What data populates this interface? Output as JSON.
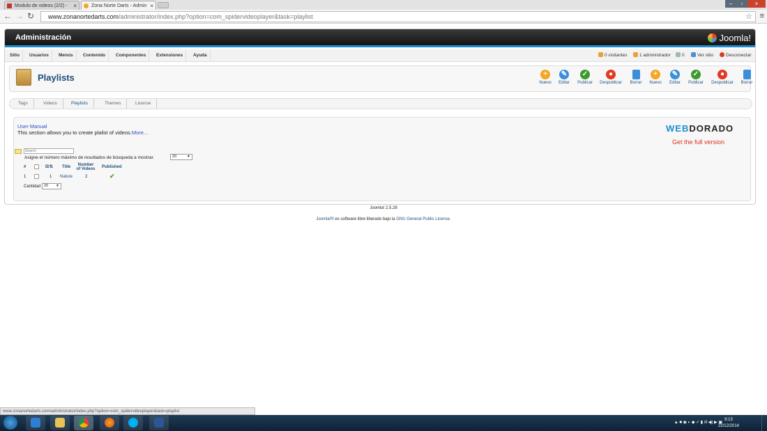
{
  "browser": {
    "tabs": [
      {
        "label": "Modulo de videos (2/2) - ",
        "active": false
      },
      {
        "label": "Zona Norte Darts - Admin",
        "active": true
      }
    ],
    "url_host": "www.zonanortedarts.com",
    "url_path": "/administrator/index.php?option=com_spidervideoplayer&task=playlist",
    "status_url": "www.zonanortedarts.com/administrator/index.php?option=com_spidervideoplayer&task=playlist"
  },
  "admin": {
    "title": "Administración",
    "brand": "Joomla!",
    "menu": [
      "Sitio",
      "Usuarios",
      "Menús",
      "Contenido",
      "Componentes",
      "Extensiones",
      "Ayuda"
    ],
    "status": {
      "visitors": "0 visitantes",
      "admins": "1 administrador",
      "messages": "0",
      "view_site": "Ver sitio",
      "logout": "Desconectar"
    }
  },
  "toolbar": {
    "page_title": "Playlists",
    "buttons": [
      {
        "label": "Nuevo",
        "icon": "plus-icon",
        "color": "#f5a623"
      },
      {
        "label": "Editar",
        "icon": "pencil-icon",
        "color": "#3a8fd8"
      },
      {
        "label": "Publicar",
        "icon": "check-icon",
        "color": "#3c9a2e"
      },
      {
        "label": "Despublicar",
        "icon": "unpublish-icon",
        "color": "#e23a22"
      },
      {
        "label": "Borrar",
        "icon": "trash-icon",
        "color": "#3a8fd8"
      },
      {
        "label": "Nuevo",
        "icon": "plus-icon",
        "color": "#f5a623"
      },
      {
        "label": "Editar",
        "icon": "pencil-icon",
        "color": "#3a8fd8"
      },
      {
        "label": "Publicar",
        "icon": "check-icon",
        "color": "#3c9a2e"
      },
      {
        "label": "Despublicar",
        "icon": "unpublish-icon",
        "color": "#e23a22"
      },
      {
        "label": "Borrar",
        "icon": "trash-icon",
        "color": "#3a8fd8"
      }
    ]
  },
  "subnav": [
    "Tags",
    "Videos",
    "Playlists",
    "Themes",
    "License"
  ],
  "content": {
    "user_manual": "User Manual",
    "description": "This section allows you to create plalist of videos.",
    "more": "More...",
    "brand_prefix": "WEB",
    "brand_suffix": "DORADO",
    "full_version": "Get the full version",
    "search_placeholder": "Search",
    "limit_label": "Asigne el número máximo de resultados de búsqueda a mostrar.",
    "limit_value": "20",
    "columns": {
      "num": "#",
      "id": "ID",
      "title": "Title",
      "number_line1": "Number",
      "number_line2": "of Videos",
      "published": "Published"
    },
    "rows": [
      {
        "num": "1",
        "id": "1",
        "title": "Nature",
        "videos": "2",
        "published": true
      }
    ],
    "quantity_label": "Cantidad",
    "quantity_value": "20"
  },
  "footer": {
    "version": "Joomla! 2.5.28",
    "brand_link": "Joomla!®",
    "license_text": " es software libre liberado bajo la ",
    "license_link": "GNU General Public License."
  },
  "taskbar": {
    "time": "9:13",
    "date": "22/12/2014"
  }
}
